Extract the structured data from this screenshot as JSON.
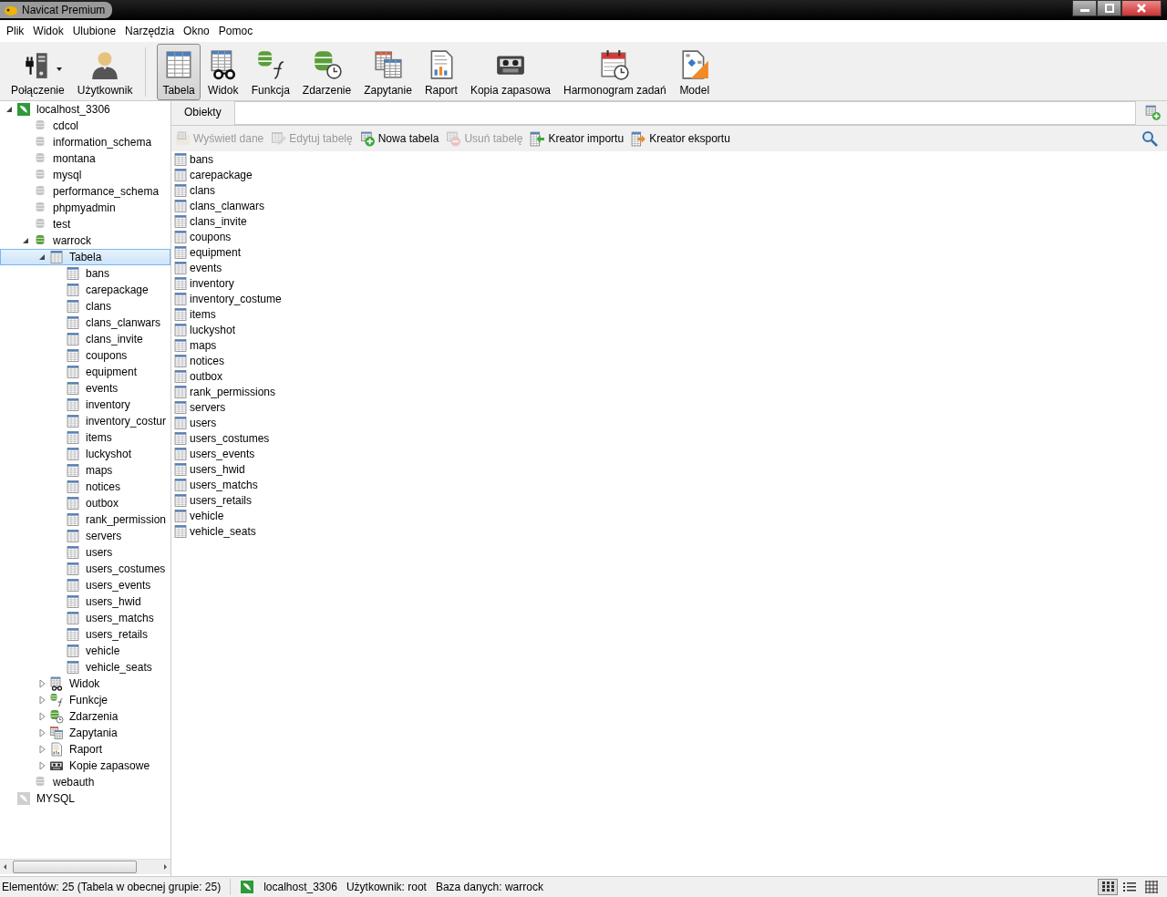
{
  "window": {
    "title": "Navicat Premium"
  },
  "menu": [
    "Plik",
    "Widok",
    "Ulubione",
    "Narzędzia",
    "Okno",
    "Pomoc"
  ],
  "toolbar": [
    {
      "label": "Połączenie",
      "kind": "connection",
      "selected": false
    },
    {
      "label": "Użytkownik",
      "kind": "user",
      "selected": false
    },
    {
      "label": "Tabela",
      "kind": "table",
      "selected": true
    },
    {
      "label": "Widok",
      "kind": "view",
      "selected": false
    },
    {
      "label": "Funkcja",
      "kind": "function",
      "selected": false
    },
    {
      "label": "Zdarzenie",
      "kind": "event",
      "selected": false
    },
    {
      "label": "Zapytanie",
      "kind": "query",
      "selected": false
    },
    {
      "label": "Raport",
      "kind": "report",
      "selected": false
    },
    {
      "label": "Kopia zapasowa",
      "kind": "backup",
      "selected": false
    },
    {
      "label": "Harmonogram zadań",
      "kind": "schedule",
      "selected": false
    },
    {
      "label": "Model",
      "kind": "model",
      "selected": false
    }
  ],
  "tree": [
    {
      "label": "localhost_3306",
      "kind": "connection",
      "connected": true,
      "expanded": true,
      "selected": false,
      "children": [
        {
          "label": "cdcol",
          "kind": "database",
          "open": false,
          "selected": false
        },
        {
          "label": "information_schema",
          "kind": "database",
          "open": false,
          "selected": false
        },
        {
          "label": "montana",
          "kind": "database",
          "open": false,
          "selected": false
        },
        {
          "label": "mysql",
          "kind": "database",
          "open": false,
          "selected": false
        },
        {
          "label": "performance_schema",
          "kind": "database",
          "open": false,
          "selected": false
        },
        {
          "label": "phpmyadmin",
          "kind": "database",
          "open": false,
          "selected": false
        },
        {
          "label": "test",
          "kind": "database",
          "open": false,
          "selected": false
        },
        {
          "label": "warrock",
          "kind": "database",
          "open": true,
          "expanded": true,
          "selected": false,
          "children": [
            {
              "label": "Tabela",
              "kind": "table",
              "expanded": true,
              "selected": true,
              "children": [
                {
                  "label": "bans",
                  "kind": "table",
                  "selected": false
                },
                {
                  "label": "carepackage",
                  "kind": "table",
                  "selected": false
                },
                {
                  "label": "clans",
                  "kind": "table",
                  "selected": false
                },
                {
                  "label": "clans_clanwars",
                  "kind": "table",
                  "selected": false
                },
                {
                  "label": "clans_invite",
                  "kind": "table",
                  "selected": false
                },
                {
                  "label": "coupons",
                  "kind": "table",
                  "selected": false
                },
                {
                  "label": "equipment",
                  "kind": "table",
                  "selected": false
                },
                {
                  "label": "events",
                  "kind": "table",
                  "selected": false
                },
                {
                  "label": "inventory",
                  "kind": "table",
                  "selected": false
                },
                {
                  "label": "inventory_costur",
                  "kind": "table",
                  "selected": false
                },
                {
                  "label": "items",
                  "kind": "table",
                  "selected": false
                },
                {
                  "label": "luckyshot",
                  "kind": "table",
                  "selected": false
                },
                {
                  "label": "maps",
                  "kind": "table",
                  "selected": false
                },
                {
                  "label": "notices",
                  "kind": "table",
                  "selected": false
                },
                {
                  "label": "outbox",
                  "kind": "table",
                  "selected": false
                },
                {
                  "label": "rank_permission",
                  "kind": "table",
                  "selected": false
                },
                {
                  "label": "servers",
                  "kind": "table",
                  "selected": false
                },
                {
                  "label": "users",
                  "kind": "table",
                  "selected": false
                },
                {
                  "label": "users_costumes",
                  "kind": "table",
                  "selected": false
                },
                {
                  "label": "users_events",
                  "kind": "table",
                  "selected": false
                },
                {
                  "label": "users_hwid",
                  "kind": "table",
                  "selected": false
                },
                {
                  "label": "users_matchs",
                  "kind": "table",
                  "selected": false
                },
                {
                  "label": "users_retails",
                  "kind": "table",
                  "selected": false
                },
                {
                  "label": "vehicle",
                  "kind": "table",
                  "selected": false
                },
                {
                  "label": "vehicle_seats",
                  "kind": "table",
                  "selected": false
                }
              ]
            },
            {
              "label": "Widok",
              "kind": "view",
              "expanded": false,
              "selected": false
            },
            {
              "label": "Funkcje",
              "kind": "function",
              "expanded": false,
              "selected": false
            },
            {
              "label": "Zdarzenia",
              "kind": "event",
              "expanded": false,
              "selected": false
            },
            {
              "label": "Zapytania",
              "kind": "query",
              "expanded": false,
              "selected": false
            },
            {
              "label": "Raport",
              "kind": "report",
              "expanded": false,
              "selected": false
            },
            {
              "label": "Kopie zapasowe",
              "kind": "backup",
              "expanded": false,
              "selected": false
            }
          ]
        },
        {
          "label": "webauth",
          "kind": "database",
          "open": false,
          "selected": false
        }
      ]
    },
    {
      "label": "MYSQL",
      "kind": "connection",
      "connected": false,
      "selected": false
    }
  ],
  "tabs": [
    {
      "label": "Obiekty",
      "selected": true
    }
  ],
  "actions": [
    {
      "label": "Wyświetl dane",
      "kind": "open",
      "disabled": true
    },
    {
      "label": "Edytuj tabelę",
      "kind": "edit",
      "disabled": true
    },
    {
      "label": "Nowa tabela",
      "kind": "add",
      "disabled": false
    },
    {
      "label": "Usuń tabelę",
      "kind": "delete",
      "disabled": true
    },
    {
      "label": "Kreator importu",
      "kind": "import",
      "disabled": false
    },
    {
      "label": "Kreator eksportu",
      "kind": "export",
      "disabled": false
    }
  ],
  "objects": [
    "bans",
    "carepackage",
    "clans",
    "clans_clanwars",
    "clans_invite",
    "coupons",
    "equipment",
    "events",
    "inventory",
    "inventory_costume",
    "items",
    "luckyshot",
    "maps",
    "notices",
    "outbox",
    "rank_permissions",
    "servers",
    "users",
    "users_costumes",
    "users_events",
    "users_hwid",
    "users_matchs",
    "users_retails",
    "vehicle",
    "vehicle_seats"
  ],
  "status_bar": {
    "summary": "Elementów: 25 (Tabela w obecnej grupie: 25)",
    "connection": "localhost_3306",
    "user": "Użytkownik: root",
    "database": "Baza danych: warrock"
  },
  "view_modes": [
    {
      "kind": "icons",
      "selected": true
    },
    {
      "kind": "list",
      "selected": false
    },
    {
      "kind": "details",
      "selected": false
    }
  ]
}
